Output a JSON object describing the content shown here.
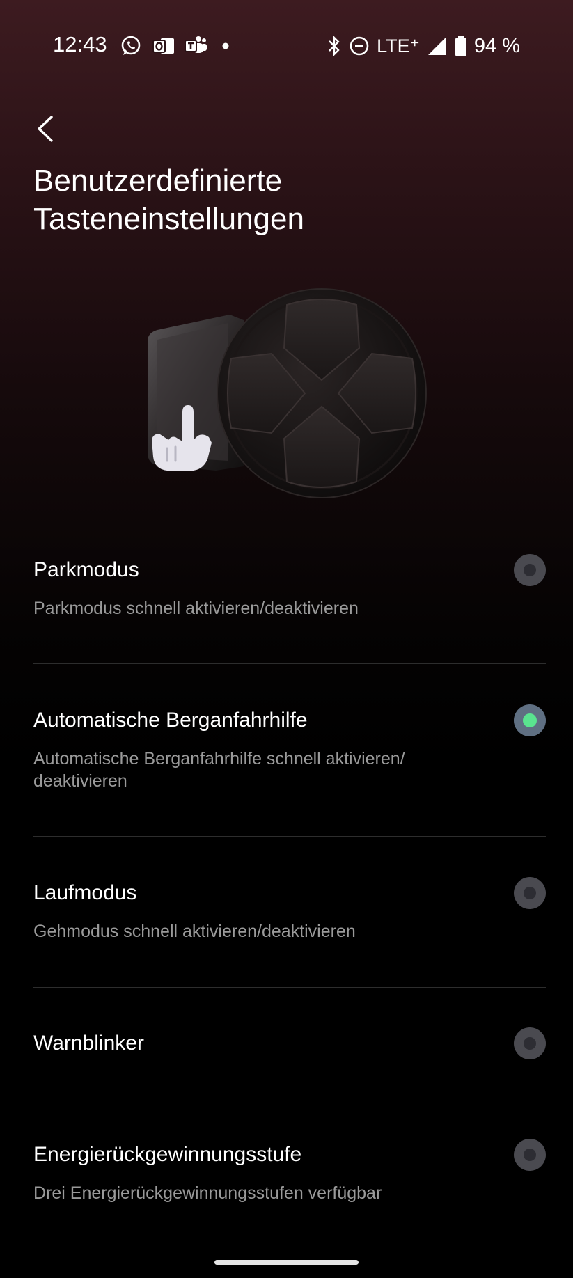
{
  "status_bar": {
    "time": "12:43",
    "network": "LTE⁺",
    "battery": "94 %",
    "notification_icons": [
      "whatsapp-icon",
      "outlook-icon",
      "teams-icon",
      "dot-icon"
    ],
    "system_icons": [
      "bluetooth-icon",
      "do-not-disturb-icon",
      "signal-icon",
      "battery-icon"
    ]
  },
  "page": {
    "title_line1": "Benutzerdefinierte",
    "title_line2": "Tasteneinstellungen"
  },
  "options": [
    {
      "title": "Parkmodus",
      "description": "Parkmodus schnell aktivieren/deaktivieren",
      "selected": false
    },
    {
      "title": "Automatische Berganfahrhilfe",
      "description": "Automatische Berganfahrhilfe schnell aktivieren/ deaktivieren",
      "selected": true
    },
    {
      "title": "Laufmodus",
      "description": "Gehmodus schnell aktivieren/deaktivieren",
      "selected": false
    },
    {
      "title": "Warnblinker",
      "description": "",
      "selected": false
    },
    {
      "title": "Energierückgewinnungsstufe",
      "description": "Drei Energierückgewinnungsstufen verfügbar",
      "selected": false
    }
  ],
  "colors": {
    "selected_dot": "#5ae38f",
    "background_top": "#3d1b20",
    "background_bottom": "#000000"
  }
}
